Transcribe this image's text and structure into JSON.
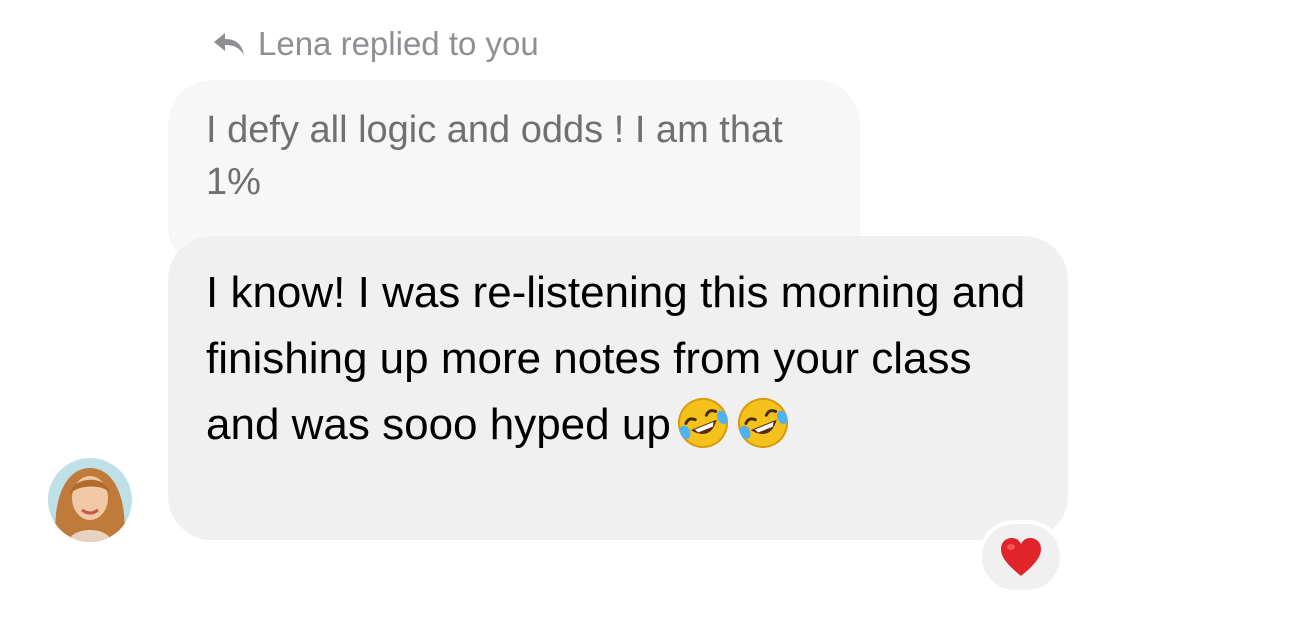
{
  "reply_header": {
    "text": "Lena replied to you",
    "icon": "reply-arrow-icon"
  },
  "quoted_message": {
    "text": "I defy all logic and odds ! I am that 1%"
  },
  "message": {
    "text": "I know! I was re-listening this morning and finishing up more notes from your class and was sooo hyped up",
    "emojis": [
      "rolling-on-floor-laughing-emoji",
      "rolling-on-floor-laughing-emoji"
    ]
  },
  "sender": {
    "avatar": "avatar-photo"
  },
  "reaction": {
    "emoji": "red-heart-icon",
    "color": "#e0242a"
  }
}
